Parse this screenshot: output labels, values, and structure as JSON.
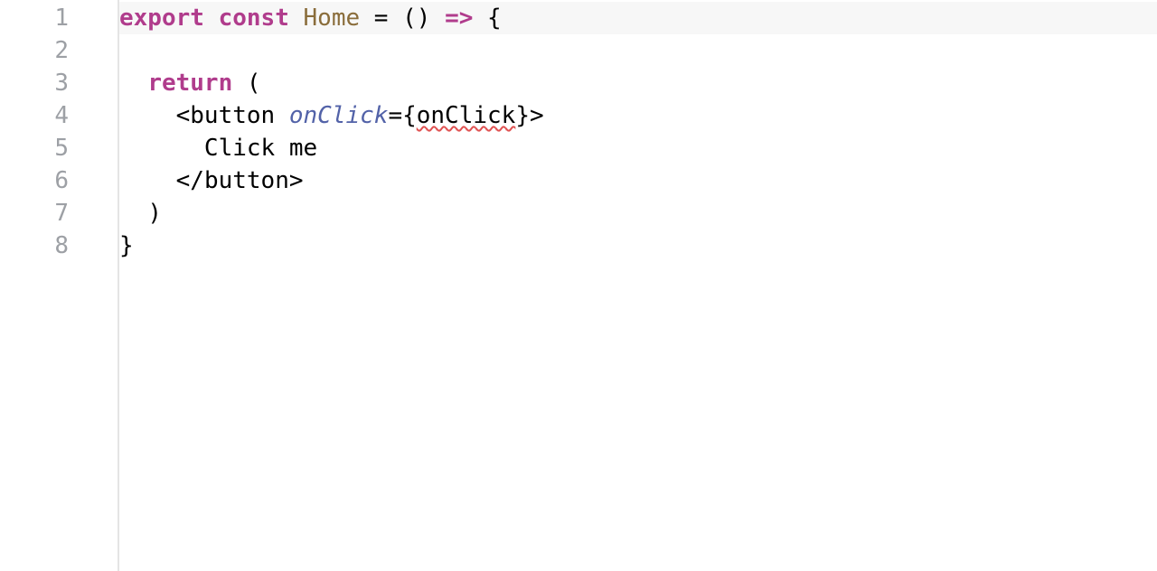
{
  "lineNumbers": [
    "1",
    "2",
    "3",
    "4",
    "5",
    "6",
    "7",
    "8"
  ],
  "line1": {
    "export": "export",
    "const": "const",
    "home": "Home",
    "eq": " = ",
    "parens": "()",
    "arrow": " => ",
    "brace": "{"
  },
  "line2": "",
  "line3": {
    "return": "return",
    "paren": " ("
  },
  "line4": {
    "lt": "<",
    "tag": "button",
    "sp": " ",
    "attr": "onClick",
    "eq": "=",
    "lb": "{",
    "handler": "onClick",
    "rb": "}",
    "gt": ">"
  },
  "line5": {
    "text": "Click me"
  },
  "line6": {
    "open": "</",
    "tag": "button",
    "close": ">"
  },
  "line7": {
    "paren": ")"
  },
  "line8": {
    "brace": "}"
  }
}
